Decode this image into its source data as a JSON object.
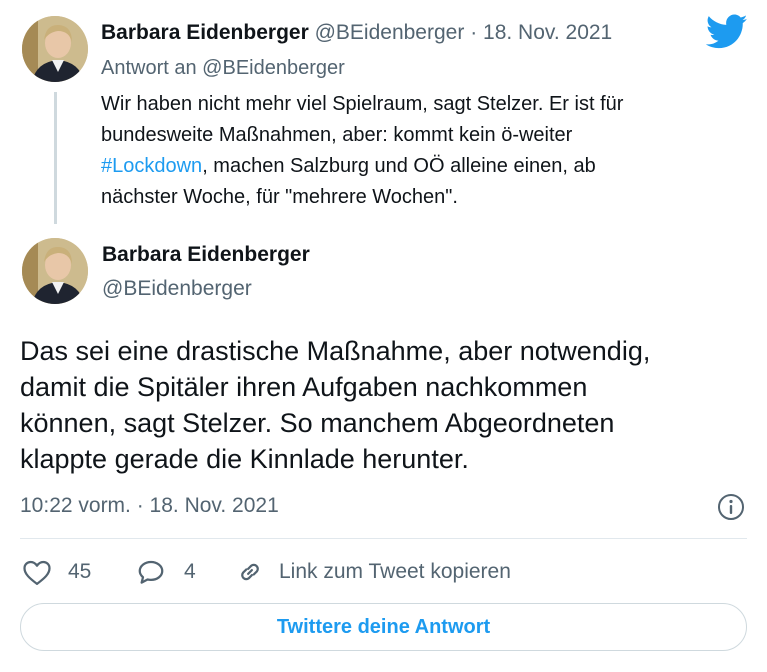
{
  "reply_tweet": {
    "author_name": "Barbara Eidenberger",
    "author_handle": "@BEidenberger",
    "separator": "·",
    "date": "18. Nov. 2021",
    "reply_to_prefix": "Antwort an ",
    "reply_to_handle": "@BEidenberger",
    "text_line1": "Wir haben nicht mehr viel Spielraum, sagt Stelzer. Er ist für",
    "text_line2": "bundesweite Maßnahmen, aber: kommt kein ö-weiter",
    "hashtag": "#Lockdown",
    "text_line3_rest": ", machen Salzburg und OÖ alleine einen, ab",
    "text_line4": "nächster Woche, für \"mehrere Wochen\"."
  },
  "main_tweet": {
    "author_name": "Barbara Eidenberger",
    "author_handle": "@BEidenberger",
    "text_line1": "Das sei eine drastische Maßnahme, aber notwendig,",
    "text_line2": "damit die Spitäler ihren Aufgaben nachkommen",
    "text_line3": "können, sagt Stelzer. So manchem Abgeordneten",
    "text_line4": "klappte gerade die Kinnlade herunter.",
    "timestamp": "10:22 vorm. · 18. Nov. 2021"
  },
  "actions": {
    "likes_count": "45",
    "replies_count": "4",
    "copy_link_label": "Link zum Tweet kopieren"
  },
  "reply_button_label": "Twittere deine Antwort",
  "colors": {
    "accent": "#1d9bf0",
    "text": "#0f1419",
    "muted": "#536471",
    "divider": "#e1e8ed"
  },
  "icons": {
    "logo": "twitter-bird-icon",
    "info": "info-icon",
    "like": "heart-icon",
    "reply": "reply-bubble-icon",
    "copy_link": "link-icon"
  }
}
